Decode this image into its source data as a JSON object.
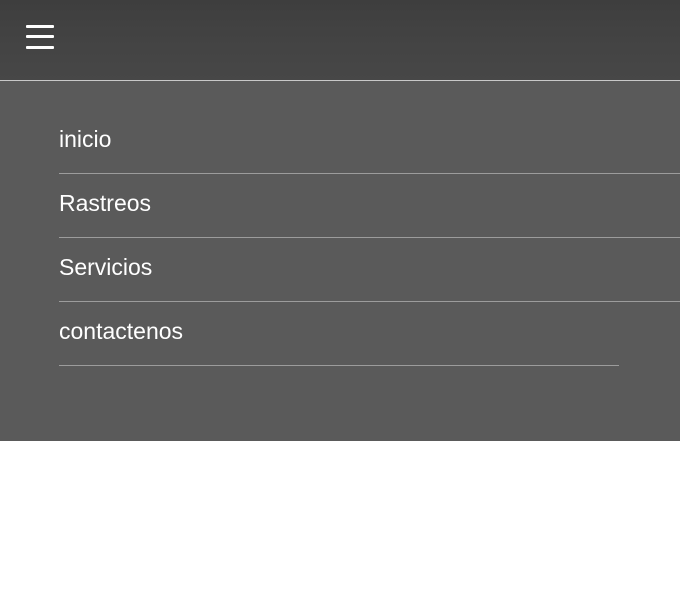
{
  "header": {
    "menu_icon": "hamburger-menu-icon"
  },
  "menu": {
    "items": [
      {
        "label": "inicio"
      },
      {
        "label": "Rastreos"
      },
      {
        "label": "Servicios"
      },
      {
        "label": "contactenos"
      }
    ]
  },
  "colors": {
    "topbar": "#444444",
    "menu_background": "#5a5a5a",
    "divider": "#9c9c9c",
    "text": "#ffffff",
    "page_background": "#ffffff"
  }
}
